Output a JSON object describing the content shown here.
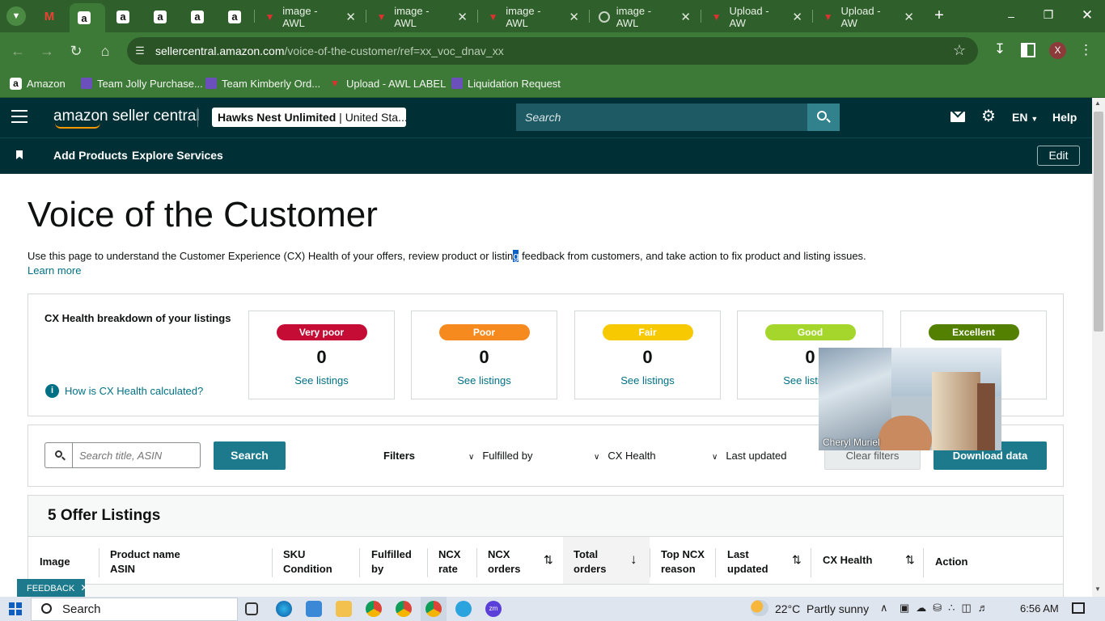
{
  "browser": {
    "tabs": [
      {
        "label": "",
        "icon": "gmail-icon"
      },
      {
        "label": "a",
        "icon": "amazon-icon"
      },
      {
        "label": "a",
        "icon": "amazon-icon"
      },
      {
        "label": "a",
        "icon": "amazon-icon"
      },
      {
        "label": "a",
        "icon": "amazon-icon"
      },
      {
        "label": "a",
        "icon": "amazon-icon"
      },
      {
        "label": "image - AWL",
        "icon": "awl-icon"
      },
      {
        "label": "image - AWL",
        "icon": "awl-icon"
      },
      {
        "label": "image - AWL",
        "icon": "awl-icon"
      },
      {
        "label": "image - AWL",
        "icon": "loading-icon"
      },
      {
        "label": "Upload - AW",
        "icon": "awl-icon"
      },
      {
        "label": "Upload - AW",
        "icon": "awl-icon"
      }
    ],
    "url_host": "sellercentral.amazon.com",
    "url_path": "/voice-of-the-customer/ref=xx_voc_dnav_xx",
    "profile_initial": "X",
    "bookmarks": [
      {
        "label": "Amazon",
        "icon": "amazon-icon"
      },
      {
        "label": "Team Jolly Purchase...",
        "icon": "forms-icon"
      },
      {
        "label": "Team Kimberly Ord...",
        "icon": "forms-icon"
      },
      {
        "label": "Upload - AWL LABEL",
        "icon": "awl-icon"
      },
      {
        "label": "Liquidation Request",
        "icon": "forms-icon"
      }
    ]
  },
  "header": {
    "logo": "amazon seller central",
    "store": "Hawks Nest Unlimited",
    "marketplace": "United Sta...",
    "search_placeholder": "Search",
    "language": "EN",
    "help": "Help",
    "nav": [
      "Add Products",
      "Explore Services"
    ],
    "edit": "Edit"
  },
  "page": {
    "title": "Voice of the Customer",
    "intro_before": "Use this page to understand the Customer Experience (CX) Health of your offers, review product or listin",
    "intro_highlight": "g",
    "intro_after": " feedback from customers, and take action to fix product and listing issues.",
    "learn_more": "Learn more"
  },
  "health": {
    "heading": "CX Health breakdown of your listings",
    "calc_link": "How is CX Health calculated?",
    "see_listings": "See listings",
    "categories": [
      {
        "label": "Very poor",
        "count": "0",
        "color": "#c40c34"
      },
      {
        "label": "Poor",
        "count": "0",
        "color": "#f68a1f"
      },
      {
        "label": "Fair",
        "count": "0",
        "color": "#f7c900"
      },
      {
        "label": "Good",
        "count": "0",
        "color": "#a5d62c"
      },
      {
        "label": "Excellent",
        "count": "",
        "color": "#538000"
      }
    ]
  },
  "filters": {
    "search_placeholder": "Search title, ASIN",
    "search_button": "Search",
    "label": "Filters",
    "fulfilled_by": "Fulfilled by",
    "cx_health": "CX Health",
    "last_updated": "Last updated",
    "clear": "Clear filters",
    "download": "Download data"
  },
  "table": {
    "title": "5 Offer Listings",
    "columns": [
      {
        "l1": "Image",
        "l2": ""
      },
      {
        "l1": "Product name",
        "l2": "ASIN"
      },
      {
        "l1": "SKU",
        "l2": "Condition"
      },
      {
        "l1": "Fulfilled",
        "l2": "by"
      },
      {
        "l1": "NCX",
        "l2": "rate"
      },
      {
        "l1": "NCX",
        "l2": "orders"
      },
      {
        "l1": "Total",
        "l2": "orders"
      },
      {
        "l1": "Top NCX",
        "l2": "reason"
      },
      {
        "l1": "Last",
        "l2": "updated"
      },
      {
        "l1": "CX Health",
        "l2": ""
      },
      {
        "l1": "Action",
        "l2": ""
      }
    ]
  },
  "video": {
    "name": "Cheryl Muriel"
  },
  "feedback": "FEEDBACK",
  "taskbar": {
    "search": "Search",
    "weather": "22°C  Partly sunny",
    "time": "6:56 AM"
  }
}
